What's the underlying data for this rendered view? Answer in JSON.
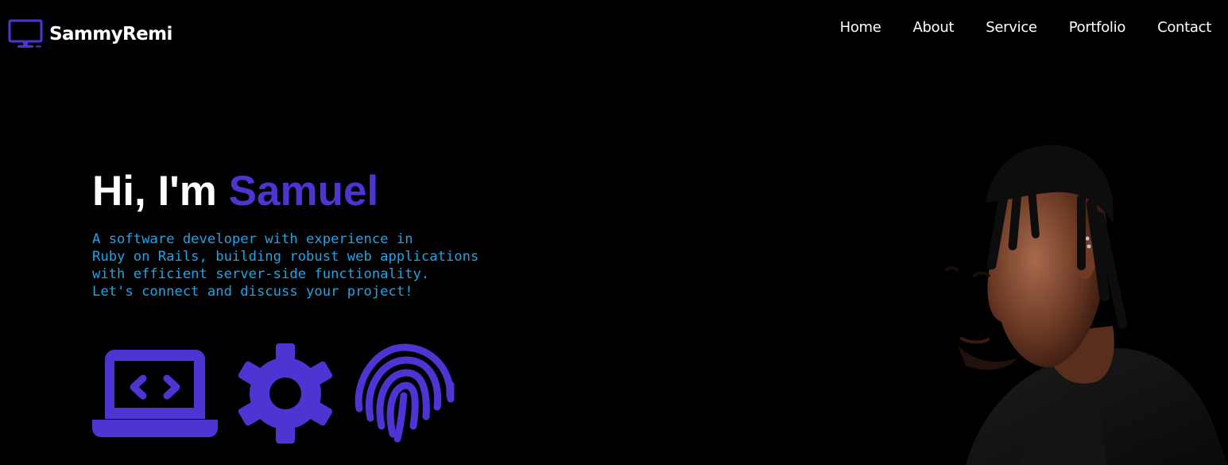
{
  "brand": {
    "name": "SammyRemi",
    "icon": "monitor-icon",
    "accent_color": "#4f34d4"
  },
  "nav": {
    "items": [
      {
        "label": "Home"
      },
      {
        "label": "About"
      },
      {
        "label": "Service"
      },
      {
        "label": "Portfolio"
      },
      {
        "label": "Contact"
      }
    ]
  },
  "hero": {
    "greeting": "Hi, I'm",
    "name": "Samuel",
    "description_lines": [
      "A software developer with experience in",
      "Ruby on Rails, building robust web applications",
      "with efficient server-side functionality.",
      "Let's connect and discuss your project!"
    ],
    "icons": [
      "laptop-code-icon",
      "gear-icon",
      "fingerprint-icon"
    ]
  },
  "colors": {
    "background": "#000000",
    "accent": "#4f34d4",
    "description_text": "#1ea4e8",
    "text": "#ffffff"
  }
}
